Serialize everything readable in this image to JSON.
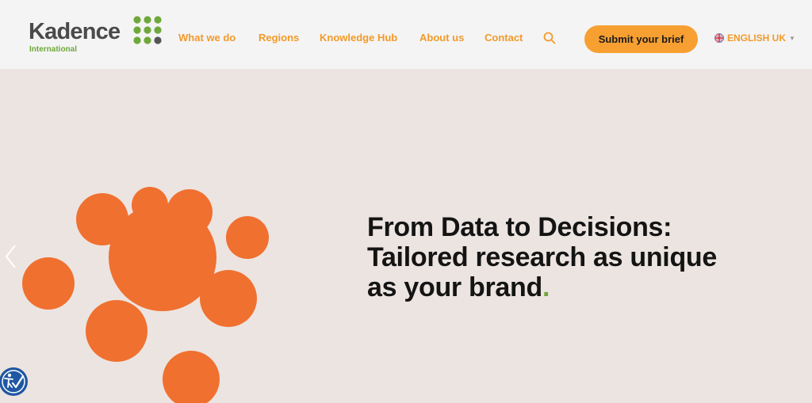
{
  "brand": {
    "name": "Kadence",
    "subtitle": "International",
    "logo_accent_color": "#6fa83a"
  },
  "nav": {
    "items": [
      {
        "label": "What we do"
      },
      {
        "label": "Regions"
      },
      {
        "label": "Knowledge Hub"
      },
      {
        "label": "About us"
      },
      {
        "label": "Contact"
      }
    ],
    "search_icon": "search-icon",
    "link_color": "#f39a2a"
  },
  "cta": {
    "label": "Submit your brief",
    "color": "#f7a031"
  },
  "language": {
    "label": "ENGLISH UK",
    "flag_icon": "uk-flag-icon"
  },
  "hero": {
    "headline_lines": [
      "From Data to Decisions:",
      "Tailored research as unique",
      "as your brand"
    ],
    "headline_end": ".",
    "background": "#ece4e0",
    "circle_color": "#f07030",
    "prev_icon": "chevron-left-icon"
  },
  "accessibility": {
    "icon": "accessibility-icon",
    "color": "#1f57a3"
  }
}
